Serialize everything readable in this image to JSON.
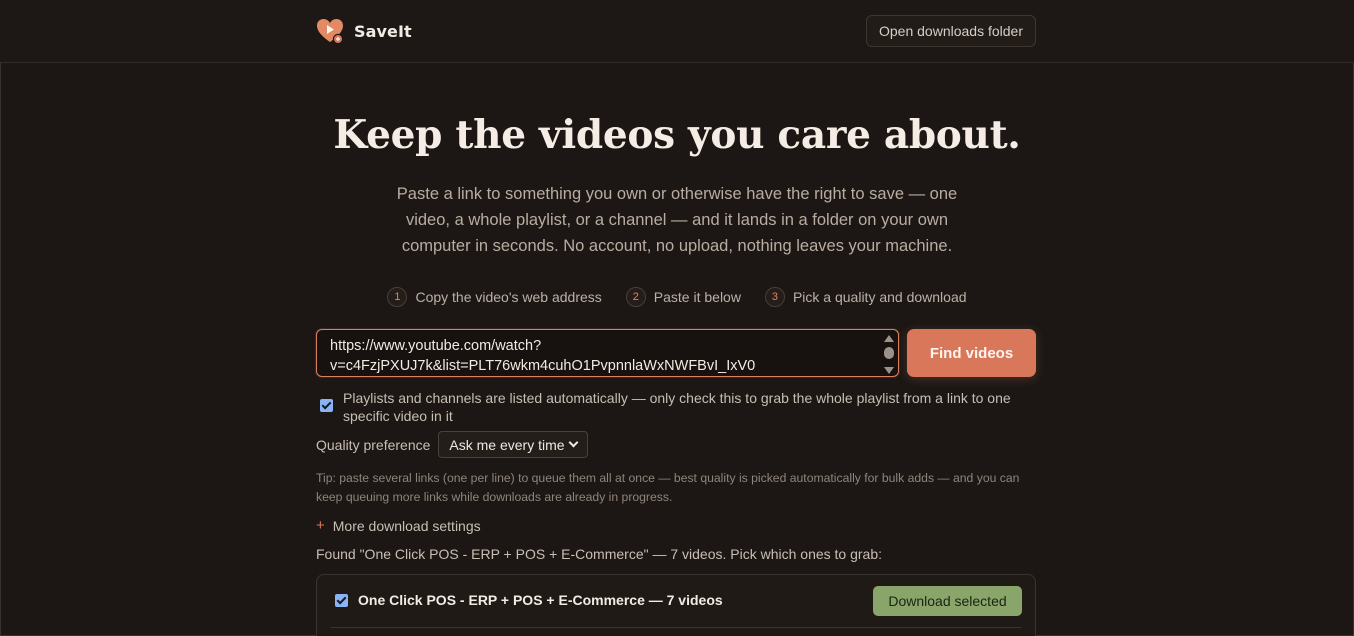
{
  "header": {
    "brand_name": "SaveIt",
    "open_folder_label": "Open downloads folder"
  },
  "hero": {
    "title": "Keep the videos you care about.",
    "subtitle": "Paste a link to something you own or otherwise have the right to save — one video, a whole playlist, or a channel — and it lands in a folder on your own computer in seconds. No account, no upload, nothing leaves your machine."
  },
  "steps": [
    {
      "num": "1",
      "label": "Copy the video's web address"
    },
    {
      "num": "2",
      "label": "Paste it below"
    },
    {
      "num": "3",
      "label": "Pick a quality and download"
    }
  ],
  "url_input": {
    "value": "https://www.youtube.com/watch?v=c4FzjPXUJ7k&list=PLT76wkm4cuhO1PvpnnlaWxNWFBvI_IxV0"
  },
  "find_button_label": "Find videos",
  "playlist_option": {
    "checked": true,
    "label": "Playlists and channels are listed automatically — only check this to grab the whole playlist from a link to one specific video in it"
  },
  "quality": {
    "label": "Quality preference",
    "selected": "Ask me every time"
  },
  "tip": "Tip: paste several links (one per line) to queue them all at once — best quality is picked automatically for bulk adds — and you can keep queuing more links while downloads are already in progress.",
  "more_settings_label": "More download settings",
  "found_text": "Found \"One Click POS - ERP + POS + E-Commerce\" — 7 videos. Pick which ones to grab:",
  "results": {
    "group_checked": true,
    "group_title": "One Click POS - ERP + POS + E-Commerce — 7 videos",
    "download_label": "Download selected"
  },
  "colors": {
    "accent": "#d9775a",
    "download_green": "#8aa56a",
    "checkbox_blue": "#8ab4f8",
    "background": "#1c1714"
  }
}
